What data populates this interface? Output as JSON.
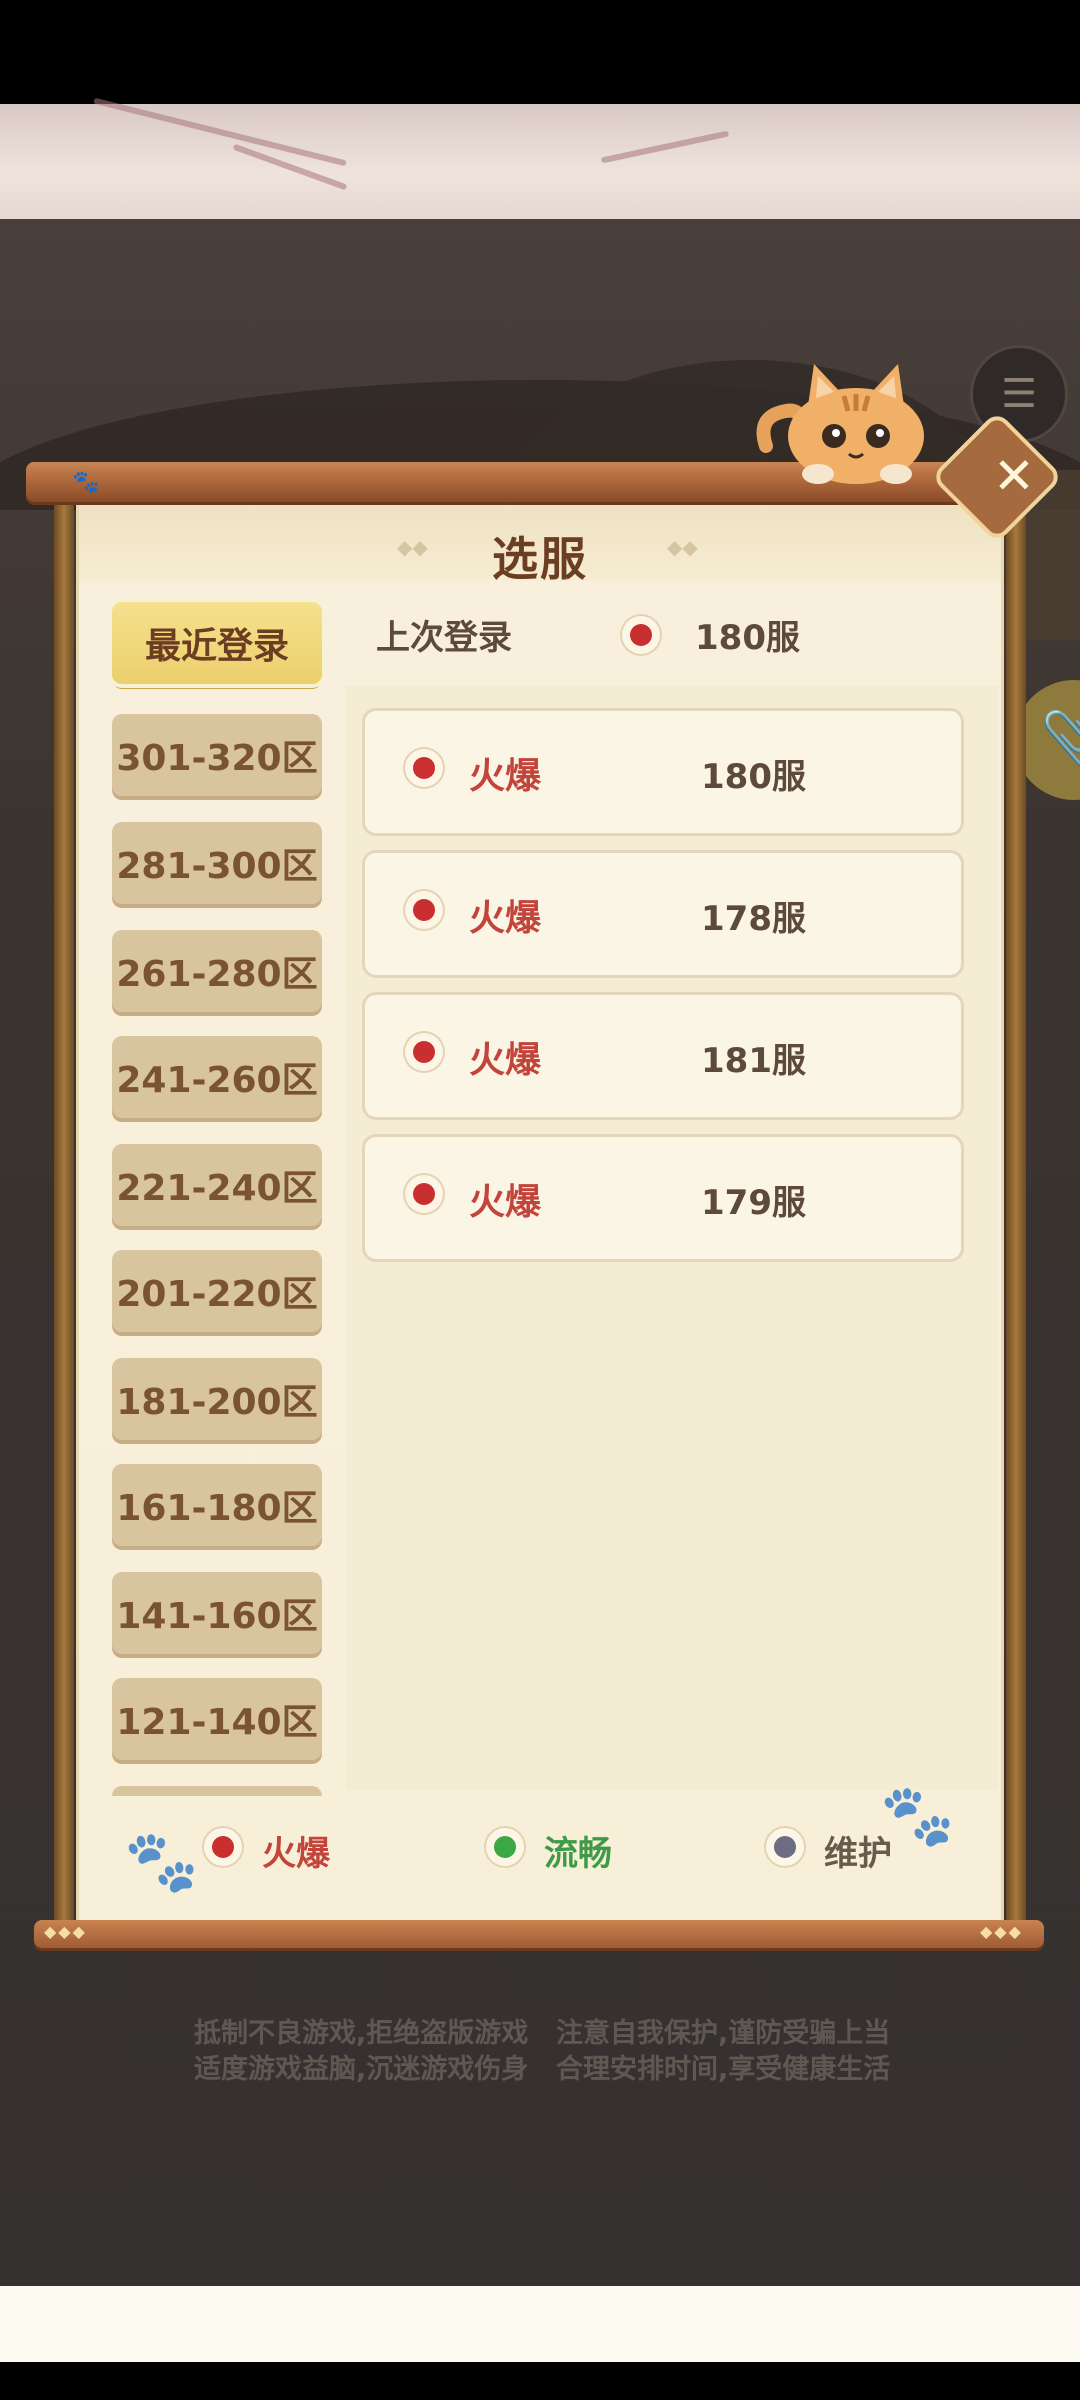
{
  "dialog": {
    "title": "选服",
    "close_icon": "close-icon"
  },
  "last_login": {
    "label": "上次登录",
    "server": "180服",
    "status_color": "#c92f2f"
  },
  "zones": [
    {
      "label": "最近登录",
      "active": true
    },
    {
      "label": "301-320区"
    },
    {
      "label": "281-300区"
    },
    {
      "label": "261-280区"
    },
    {
      "label": "241-260区"
    },
    {
      "label": "221-240区"
    },
    {
      "label": "201-220区"
    },
    {
      "label": "181-200区"
    },
    {
      "label": "161-180区"
    },
    {
      "label": "141-160区"
    },
    {
      "label": "121-140区"
    }
  ],
  "servers": [
    {
      "status": "火爆",
      "name": "180服"
    },
    {
      "status": "火爆",
      "name": "178服"
    },
    {
      "status": "火爆",
      "name": "181服"
    },
    {
      "status": "火爆",
      "name": "179服"
    }
  ],
  "legend": {
    "hot": {
      "label": "火爆",
      "color": "#c92f2f"
    },
    "smooth": {
      "label": "流畅",
      "color": "#3aa843"
    },
    "maintain": {
      "label": "维护",
      "color": "#6e6c85"
    }
  },
  "notice": {
    "line1_left": "抵制不良游戏,拒绝盗版游戏",
    "line1_right": "注意自我保护,谨防受骗上当",
    "line2_left": "适度游戏益脑,沉迷游戏伤身",
    "line2_right": "合理安排时间,享受健康生活"
  }
}
